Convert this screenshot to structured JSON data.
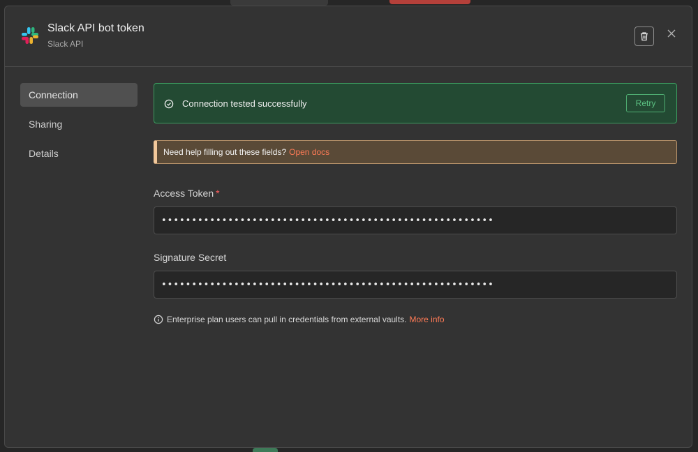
{
  "header": {
    "title": "Slack API bot token",
    "subtitle": "Slack API",
    "logo_icon": "slack-logo",
    "delete_icon": "trash-icon",
    "close_icon": "close-icon"
  },
  "sidebar": {
    "items": [
      {
        "label": "Connection",
        "active": true
      },
      {
        "label": "Sharing",
        "active": false
      },
      {
        "label": "Details",
        "active": false
      }
    ]
  },
  "connection": {
    "status_text": "Connection tested successfully",
    "retry_label": "Retry",
    "docs_prompt": "Need help filling out these fields?",
    "docs_link": "Open docs",
    "fields": [
      {
        "label": "Access Token",
        "required": "*",
        "value": "•••••••••••••••••••••••••••••••••••••••••••••••••••••••"
      },
      {
        "label": "Signature Secret",
        "value": "•••••••••••••••••••••••••••••••••••••••••••••••••••••••"
      }
    ],
    "vault_note": "Enterprise plan users can pull in credentials from external vaults.",
    "vault_link": "More info"
  },
  "colors": {
    "success_bg": "#234a33",
    "success_border": "#3c9b5f",
    "warning_bg": "#5a4a37",
    "warning_accent": "#f2c89b",
    "link": "#ff7b56"
  }
}
